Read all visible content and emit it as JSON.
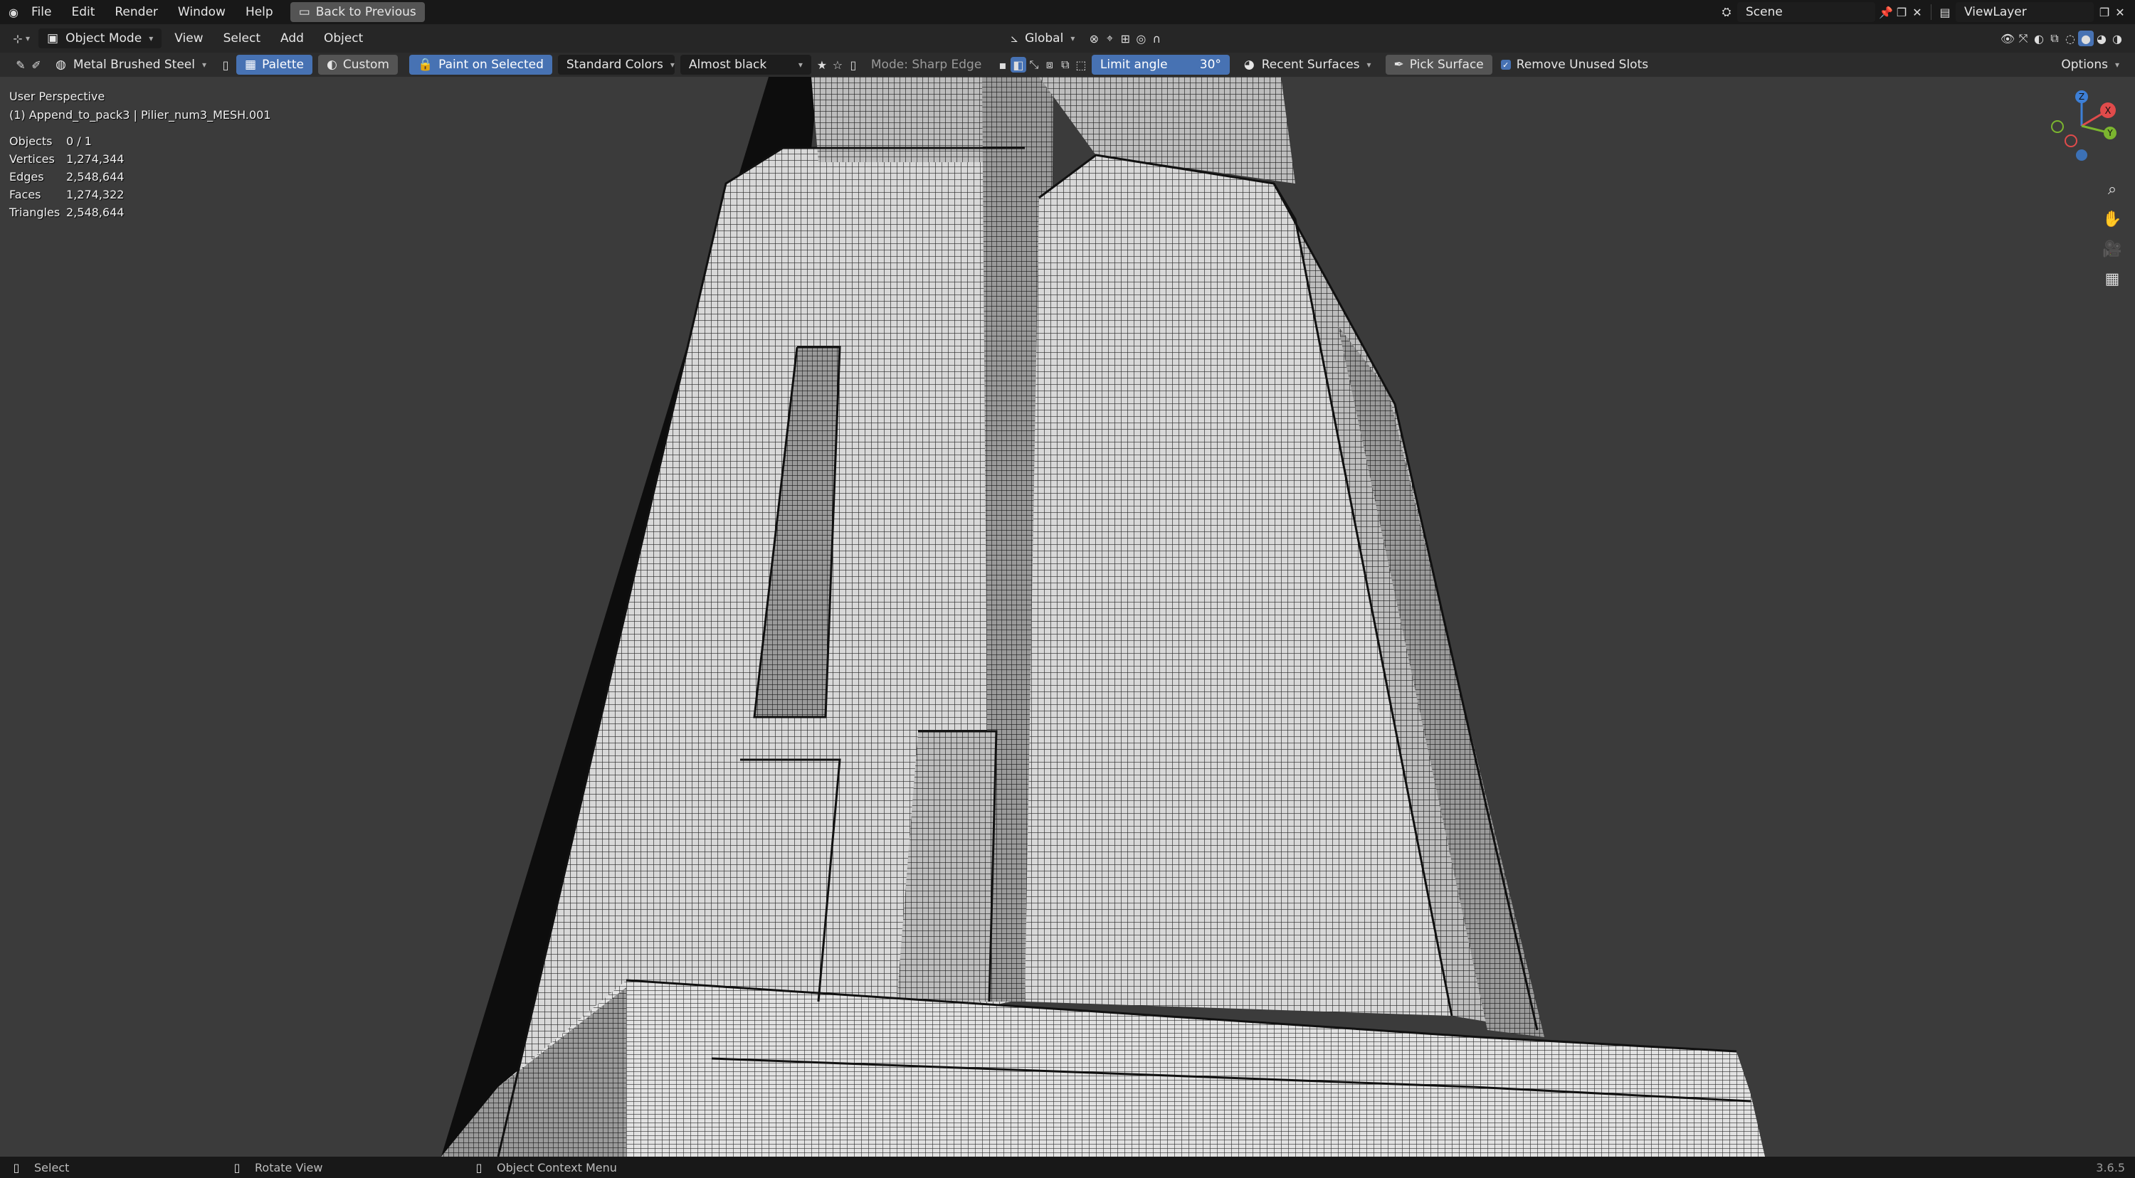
{
  "topbar": {
    "menus": [
      "File",
      "Edit",
      "Render",
      "Window",
      "Help"
    ],
    "back_button": "Back to Previous",
    "scene": "Scene",
    "view_layer": "ViewLayer"
  },
  "header": {
    "mode": "Object Mode",
    "menus": [
      "View",
      "Select",
      "Add",
      "Object"
    ],
    "transform_orientation": "Global"
  },
  "toolhdr": {
    "material": "Metal Brushed Steel",
    "palette": "Palette",
    "custom": "Custom",
    "paint_on_selected": "Paint on Selected",
    "color_set": "Standard Colors",
    "color": "Almost black",
    "mode": "Mode: Sharp Edge",
    "limit_angle_label": "Limit angle",
    "limit_angle_value": "30°",
    "recent_surfaces": "Recent Surfaces",
    "pick_surface": "Pick Surface",
    "remove_unused_slots": "Remove Unused Slots",
    "options": "Options"
  },
  "viewport": {
    "perspective": "User Perspective",
    "object_info": "(1) Append_to_pack3 | Pilier_num3_MESH.001",
    "stats": [
      {
        "label": "Objects",
        "value": "0 / 1"
      },
      {
        "label": "Vertices",
        "value": "1,274,344"
      },
      {
        "label": "Edges",
        "value": "2,548,644"
      },
      {
        "label": "Faces",
        "value": "1,274,322"
      },
      {
        "label": "Triangles",
        "value": "2,548,644"
      }
    ],
    "gizmo_axes": {
      "x": "X",
      "y": "Y",
      "z": "Z"
    }
  },
  "statusbar": {
    "select": "Select",
    "rotate": "Rotate View",
    "context": "Object Context Menu",
    "version": "3.6.5"
  },
  "colors": {
    "accent": "#4772b3",
    "axis_x": "#e04b4b",
    "axis_y": "#7bb52f",
    "axis_z": "#3d7fd6"
  }
}
